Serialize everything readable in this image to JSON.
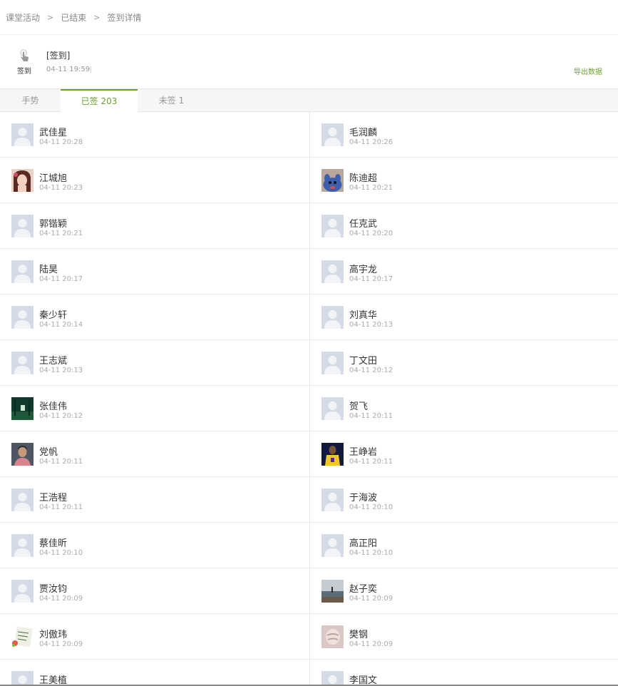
{
  "breadcrumb": {
    "item1": "课堂活动",
    "item2": "已结束",
    "item3": "签到详情"
  },
  "activity": {
    "type_label": "签到",
    "title": "[签到]",
    "time": "04-11 19:59",
    "export_label": "导出数据"
  },
  "tabs": {
    "gesture": "手势",
    "signed": "已签 203",
    "unsigned": "未签 1"
  },
  "rows": [
    [
      {
        "name": "武佳星",
        "time": "04-11 20:28",
        "avatar": "default"
      },
      {
        "name": "毛润麟",
        "time": "04-11 20:26",
        "avatar": "default"
      }
    ],
    [
      {
        "name": "江城旭",
        "time": "04-11 20:23",
        "avatar": "photo-girl"
      },
      {
        "name": "陈迪超",
        "time": "04-11 20:21",
        "avatar": "photo-cartoon"
      }
    ],
    [
      {
        "name": "郭锴颖",
        "time": "04-11 20:21",
        "avatar": "default"
      },
      {
        "name": "任克武",
        "time": "04-11 20:20",
        "avatar": "default"
      }
    ],
    [
      {
        "name": "陆昊",
        "time": "04-11 20:17",
        "avatar": "default"
      },
      {
        "name": "高宇龙",
        "time": "04-11 20:17",
        "avatar": "default"
      }
    ],
    [
      {
        "name": "秦少轩",
        "time": "04-11 20:14",
        "avatar": "default"
      },
      {
        "name": "刘真华",
        "time": "04-11 20:13",
        "avatar": "default"
      }
    ],
    [
      {
        "name": "王志斌",
        "time": "04-11 20:13",
        "avatar": "default"
      },
      {
        "name": "丁文田",
        "time": "04-11 20:12",
        "avatar": "default"
      }
    ],
    [
      {
        "name": "张佳伟",
        "time": "04-11 20:12",
        "avatar": "photo-forest"
      },
      {
        "name": "贺飞",
        "time": "04-11 20:11",
        "avatar": "default"
      }
    ],
    [
      {
        "name": "党帆",
        "time": "04-11 20:11",
        "avatar": "photo-man"
      },
      {
        "name": "王峥岩",
        "time": "04-11 20:11",
        "avatar": "photo-jersey"
      }
    ],
    [
      {
        "name": "王浩程",
        "time": "04-11 20:11",
        "avatar": "default"
      },
      {
        "name": "于海波",
        "time": "04-11 20:10",
        "avatar": "default"
      }
    ],
    [
      {
        "name": "蔡佳昕",
        "time": "04-11 20:10",
        "avatar": "default"
      },
      {
        "name": "高正阳",
        "time": "04-11 20:10",
        "avatar": "default"
      }
    ],
    [
      {
        "name": "贾汝钧",
        "time": "04-11 20:09",
        "avatar": "default"
      },
      {
        "name": "赵子奕",
        "time": "04-11 20:09",
        "avatar": "photo-sea"
      }
    ],
    [
      {
        "name": "刘傲玮",
        "time": "04-11 20:09",
        "avatar": "photo-note"
      },
      {
        "name": "樊钢",
        "time": "04-11 20:09",
        "avatar": "photo-hand"
      }
    ],
    [
      {
        "name": "王美植",
        "time": "",
        "avatar": "default"
      },
      {
        "name": "李国文",
        "time": "",
        "avatar": "default"
      }
    ]
  ],
  "colors": {
    "accent": "#6aa12c",
    "avatar_default_bg": "#d5dbe6"
  }
}
